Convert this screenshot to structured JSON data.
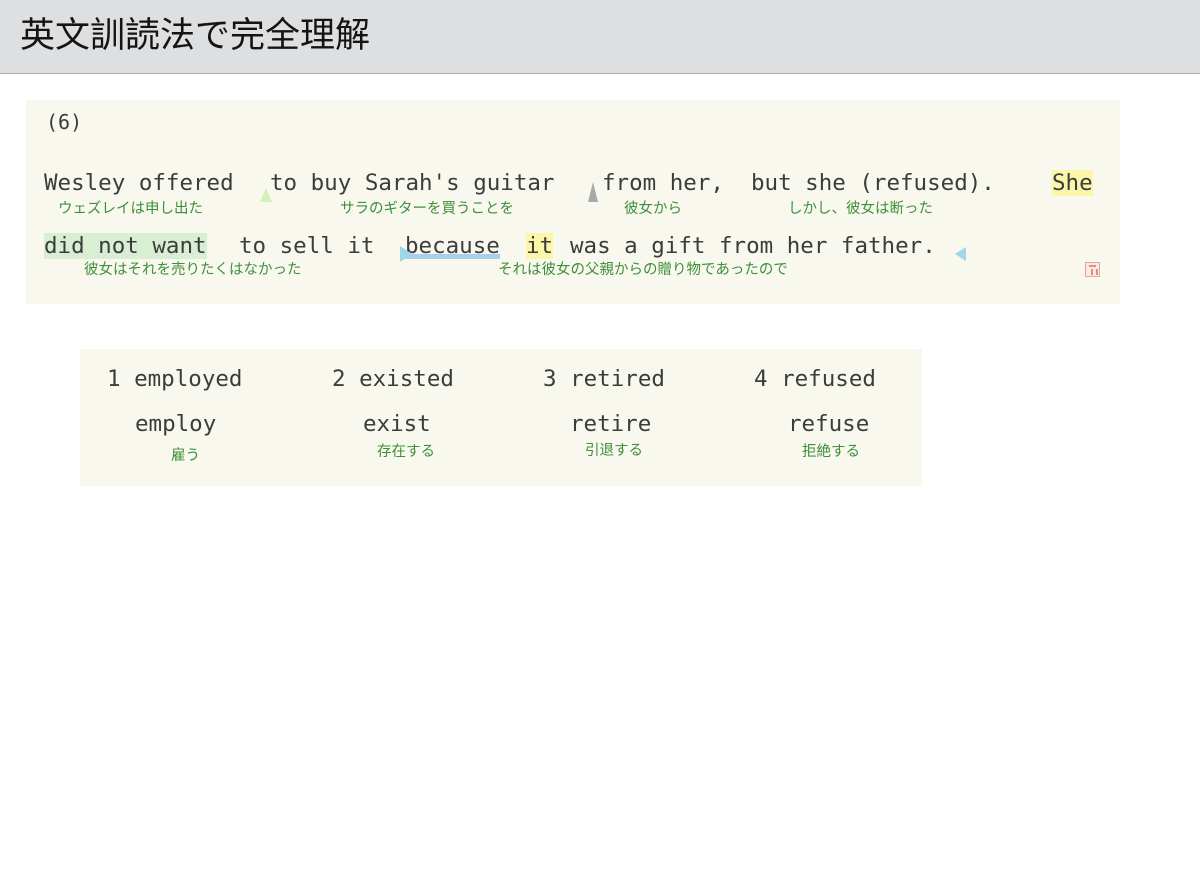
{
  "window": {
    "title": "英文訓読法で完全理解"
  },
  "question": {
    "number": "(6)",
    "line1": {
      "w1": "Wesley offered",
      "w2": "to buy Sarah's guitar",
      "w3": "from her,",
      "w4": "but she (refused).",
      "w5": "She"
    },
    "line1_glosses": {
      "g1": "ウェズレイは申し出た",
      "g2": "サラのギターを買うことを",
      "g3": "彼女から",
      "g4": "しかし、彼女は断った"
    },
    "line2": {
      "w1": "did not want",
      "w2": "to sell it",
      "w3": "because",
      "w4": "it",
      "w5": "was a gift from her father."
    },
    "line2_glosses": {
      "g1": "彼女はそれを売りたくはなかった",
      "g2": "それは彼女の父親からの贈り物であったので"
    },
    "stamp_icon": "stamp-icon"
  },
  "choices": [
    {
      "label": "1 employed",
      "base": "employ",
      "meaning": "雇う"
    },
    {
      "label": "2 existed",
      "base": "exist",
      "meaning": "存在する"
    },
    {
      "label": "3 retired",
      "base": "retire",
      "meaning": "引退する"
    },
    {
      "label": "4 refused",
      "base": "refuse",
      "meaning": "拒絶する"
    }
  ],
  "colors": {
    "gloss_green": "#3f8f3a",
    "highlight_yellow": "#fbf6a8",
    "highlight_green": "#d8efd4",
    "underline_blue": "#aacfee",
    "panel_bg": "#f8f8ee"
  }
}
